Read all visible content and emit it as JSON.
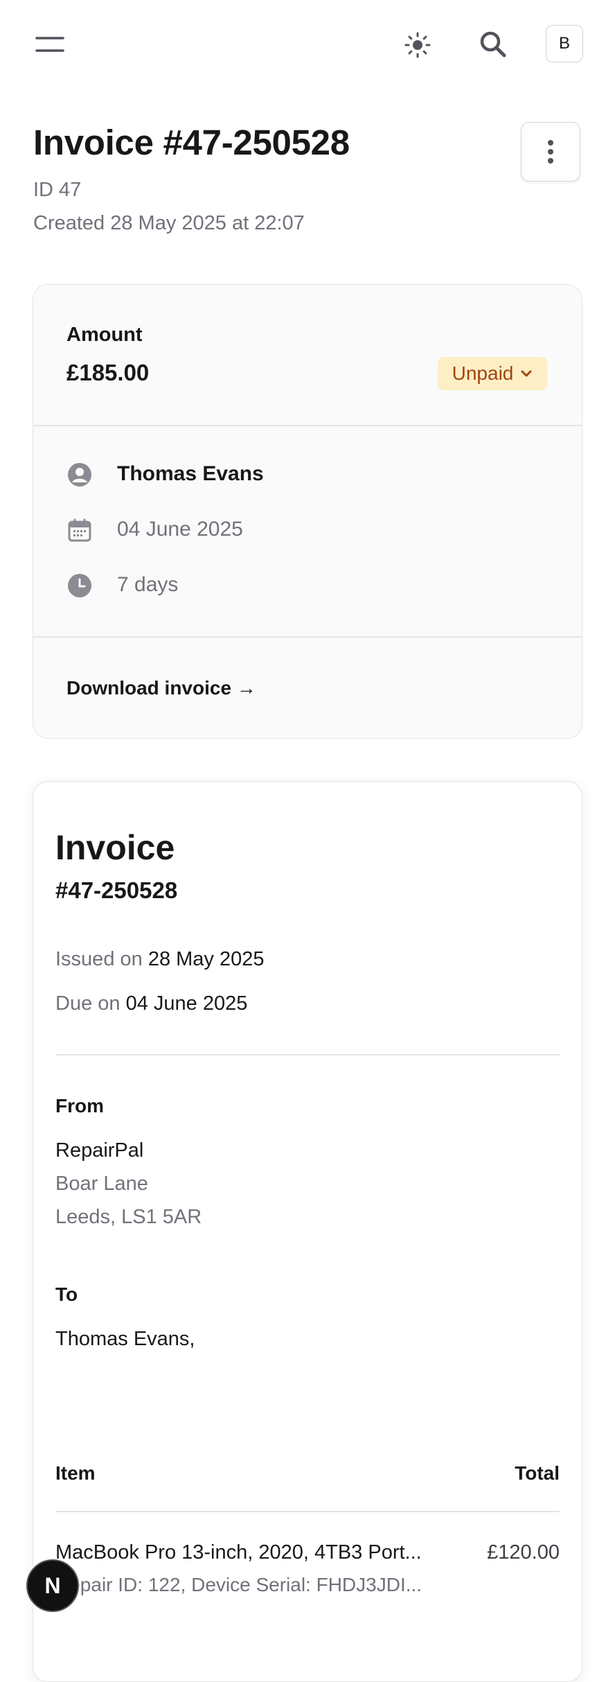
{
  "header": {
    "avatar_letter": "B"
  },
  "page": {
    "title": "Invoice #47-250528",
    "id_text": "ID 47",
    "created_text": "Created 28 May 2025 at 22:07"
  },
  "summary": {
    "amount_label": "Amount",
    "amount_value": "£185.00",
    "status_label": "Unpaid",
    "status_color": "#a1450f",
    "status_bg": "#fdeec5",
    "customer_name": "Thomas Evans",
    "due_date": "04 June 2025",
    "terms": "7 days",
    "download_label": "Download invoice →"
  },
  "invoice": {
    "heading": "Invoice",
    "number": "#47-250528",
    "issued_label": "Issued on",
    "issued_date": "28 May 2025",
    "due_label": "Due on",
    "due_date": "04 June 2025",
    "from_label": "From",
    "from_name": "RepairPal",
    "from_line1": "Boar Lane",
    "from_line2": "Leeds, LS1 5AR",
    "to_label": "To",
    "to_name": "Thomas Evans,",
    "table": {
      "col_item": "Item",
      "col_total": "Total",
      "rows": [
        {
          "title": "MacBook Pro 13-inch, 2020, 4TB3 Port...",
          "subtitle": "Repair ID: 122, Device Serial: FHDJ3JDI...",
          "total": "£120.00"
        }
      ]
    }
  },
  "dev_badge": {
    "letter": "N"
  }
}
